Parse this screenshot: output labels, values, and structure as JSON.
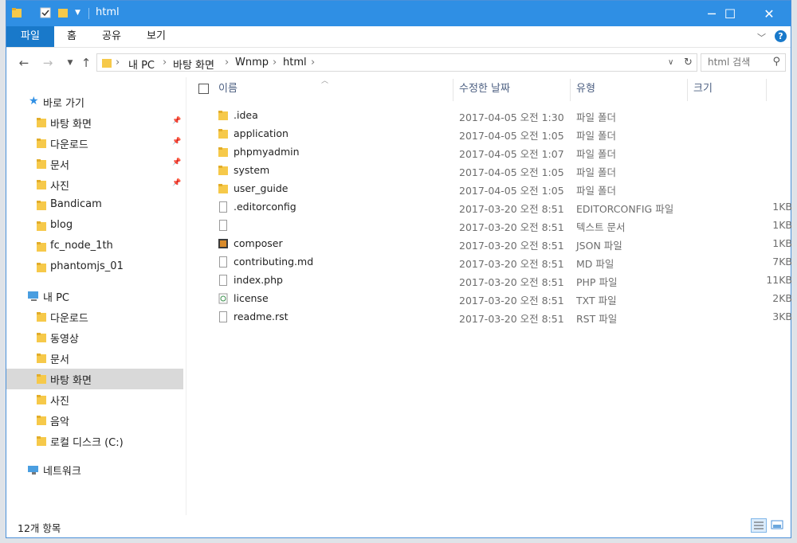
{
  "window": {
    "title": "html",
    "controls": {
      "minimize": "─",
      "maximize": "☐",
      "close": "✕"
    }
  },
  "ribbon": {
    "tabs": [
      {
        "label": "파일",
        "active": true
      },
      {
        "label": "홈",
        "active": false
      },
      {
        "label": "공유",
        "active": false
      },
      {
        "label": "보기",
        "active": false
      }
    ]
  },
  "address": {
    "crumbs": [
      "내 PC",
      "바탕 화면",
      "Wnmp",
      "html"
    ],
    "search_placeholder": "html 검색"
  },
  "nav": {
    "quick_access_label": "바로 가기",
    "quick_access": [
      {
        "label": "바탕 화면",
        "icon": "desktop-icon",
        "pinned": true
      },
      {
        "label": "다운로드",
        "icon": "download-icon",
        "pinned": true
      },
      {
        "label": "문서",
        "icon": "document-icon",
        "pinned": true
      },
      {
        "label": "사진",
        "icon": "pictures-icon",
        "pinned": true
      },
      {
        "label": "Bandicam",
        "icon": "folder-icon",
        "pinned": false
      },
      {
        "label": "blog",
        "icon": "folder-icon",
        "pinned": false
      },
      {
        "label": "fc_node_1th",
        "icon": "folder-icon",
        "pinned": false
      },
      {
        "label": "phantomjs_01",
        "icon": "folder-icon",
        "pinned": false
      }
    ],
    "this_pc_label": "내 PC",
    "this_pc": [
      {
        "label": "다운로드",
        "icon": "download-icon"
      },
      {
        "label": "동영상",
        "icon": "video-icon"
      },
      {
        "label": "문서",
        "icon": "document-icon"
      },
      {
        "label": "바탕 화면",
        "icon": "desktop-icon",
        "selected": true
      },
      {
        "label": "사진",
        "icon": "pictures-icon"
      },
      {
        "label": "음악",
        "icon": "music-icon"
      },
      {
        "label": "로컬 디스크 (C:)",
        "icon": "drive-icon"
      }
    ],
    "network_label": "네트워크"
  },
  "columns": {
    "name": "이름",
    "date": "수정한 날짜",
    "type": "유형",
    "size": "크기"
  },
  "files": [
    {
      "name": ".idea",
      "date": "2017-04-05 오전 1:30",
      "type": "파일 폴더",
      "size": "",
      "kind": "folder"
    },
    {
      "name": "application",
      "date": "2017-04-05 오전 1:05",
      "type": "파일 폴더",
      "size": "",
      "kind": "folder"
    },
    {
      "name": "phpmyadmin",
      "date": "2017-04-05 오전 1:07",
      "type": "파일 폴더",
      "size": "",
      "kind": "folder"
    },
    {
      "name": "system",
      "date": "2017-04-05 오전 1:05",
      "type": "파일 폴더",
      "size": "",
      "kind": "folder"
    },
    {
      "name": "user_guide",
      "date": "2017-04-05 오전 1:05",
      "type": "파일 폴더",
      "size": "",
      "kind": "folder"
    },
    {
      "name": ".editorconfig",
      "date": "2017-03-20 오전 8:51",
      "type": "EDITORCONFIG 파일",
      "size": "1KB",
      "kind": "file"
    },
    {
      "name": "",
      "date": "2017-03-20 오전 8:51",
      "type": "텍스트 문서",
      "size": "1KB",
      "kind": "text"
    },
    {
      "name": "composer",
      "date": "2017-03-20 오전 8:51",
      "type": "JSON 파일",
      "size": "1KB",
      "kind": "json"
    },
    {
      "name": "contributing.md",
      "date": "2017-03-20 오전 8:51",
      "type": "MD 파일",
      "size": "7KB",
      "kind": "file"
    },
    {
      "name": "index.php",
      "date": "2017-03-20 오전 8:51",
      "type": "PHP 파일",
      "size": "11KB",
      "kind": "file"
    },
    {
      "name": "license",
      "date": "2017-03-20 오전 8:51",
      "type": "TXT 파일",
      "size": "2KB",
      "kind": "txt"
    },
    {
      "name": "readme.rst",
      "date": "2017-03-20 오전 8:51",
      "type": "RST 파일",
      "size": "3KB",
      "kind": "file"
    }
  ],
  "status": {
    "item_count": "12개 항목"
  },
  "colors": {
    "title_bar": "#2f8fe4",
    "active_tab": "#1979ca",
    "folder": "#f6c94a",
    "selection": "#d9d9d9"
  }
}
